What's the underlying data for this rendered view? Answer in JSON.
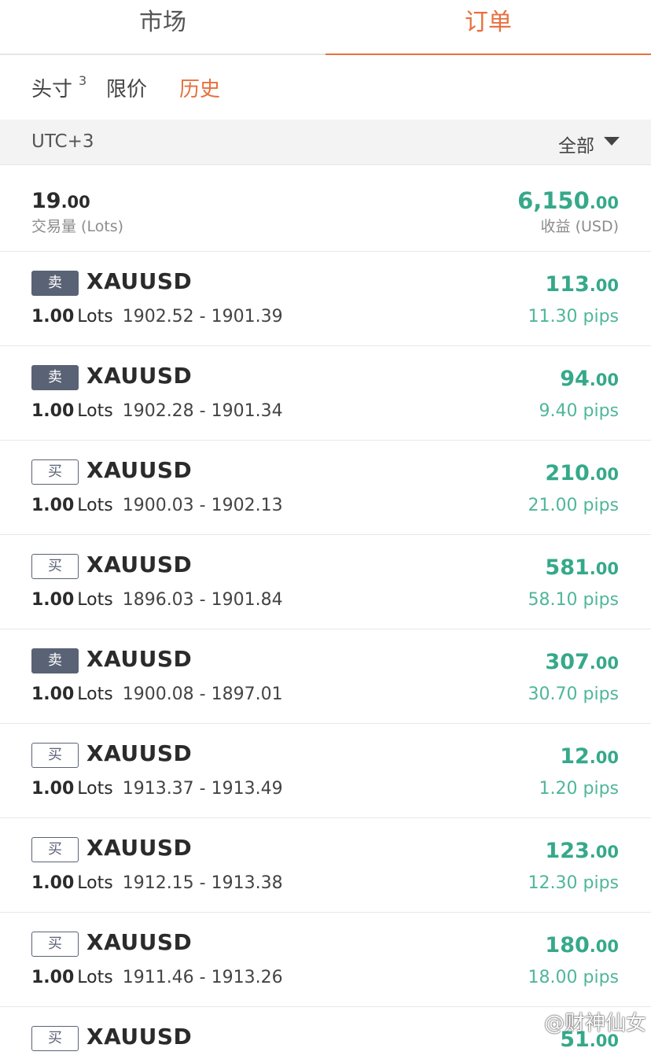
{
  "tabs": {
    "market": "市场",
    "orders": "订单"
  },
  "subtabs": {
    "positions": "头寸",
    "positions_count": "3",
    "limit": "限价",
    "history": "历史"
  },
  "filter": {
    "timezone": "UTC+3",
    "scope": "全部"
  },
  "summary": {
    "volume_int": "19",
    "volume_dec": ".00",
    "volume_label": "交易量 (Lots)",
    "profit_int": "6,150",
    "profit_dec": ".00",
    "profit_label": "收益 (USD)"
  },
  "trades": [
    {
      "side": "卖",
      "symbol": "XAUUSD",
      "lots": "1.00",
      "lots_unit": "Lots",
      "prices": "1902.52 - 1901.39",
      "profit_int": "113",
      "profit_dec": ".00",
      "pips": "11.30 pips"
    },
    {
      "side": "卖",
      "symbol": "XAUUSD",
      "lots": "1.00",
      "lots_unit": "Lots",
      "prices": "1902.28 - 1901.34",
      "profit_int": "94",
      "profit_dec": ".00",
      "pips": "9.40 pips"
    },
    {
      "side": "买",
      "symbol": "XAUUSD",
      "lots": "1.00",
      "lots_unit": "Lots",
      "prices": "1900.03 - 1902.13",
      "profit_int": "210",
      "profit_dec": ".00",
      "pips": "21.00 pips"
    },
    {
      "side": "买",
      "symbol": "XAUUSD",
      "lots": "1.00",
      "lots_unit": "Lots",
      "prices": "1896.03 - 1901.84",
      "profit_int": "581",
      "profit_dec": ".00",
      "pips": "58.10 pips"
    },
    {
      "side": "卖",
      "symbol": "XAUUSD",
      "lots": "1.00",
      "lots_unit": "Lots",
      "prices": "1900.08 - 1897.01",
      "profit_int": "307",
      "profit_dec": ".00",
      "pips": "30.70 pips"
    },
    {
      "side": "买",
      "symbol": "XAUUSD",
      "lots": "1.00",
      "lots_unit": "Lots",
      "prices": "1913.37 - 1913.49",
      "profit_int": "12",
      "profit_dec": ".00",
      "pips": "1.20 pips"
    },
    {
      "side": "买",
      "symbol": "XAUUSD",
      "lots": "1.00",
      "lots_unit": "Lots",
      "prices": "1912.15 - 1913.38",
      "profit_int": "123",
      "profit_dec": ".00",
      "pips": "12.30 pips"
    },
    {
      "side": "买",
      "symbol": "XAUUSD",
      "lots": "1.00",
      "lots_unit": "Lots",
      "prices": "1911.46 - 1913.26",
      "profit_int": "180",
      "profit_dec": ".00",
      "pips": "18.00 pips"
    },
    {
      "side": "买",
      "symbol": "XAUUSD",
      "lots": "",
      "lots_unit": "",
      "prices": "",
      "profit_int": "51",
      "profit_dec": ".00",
      "pips": ""
    }
  ],
  "watermark": "@财神仙女"
}
